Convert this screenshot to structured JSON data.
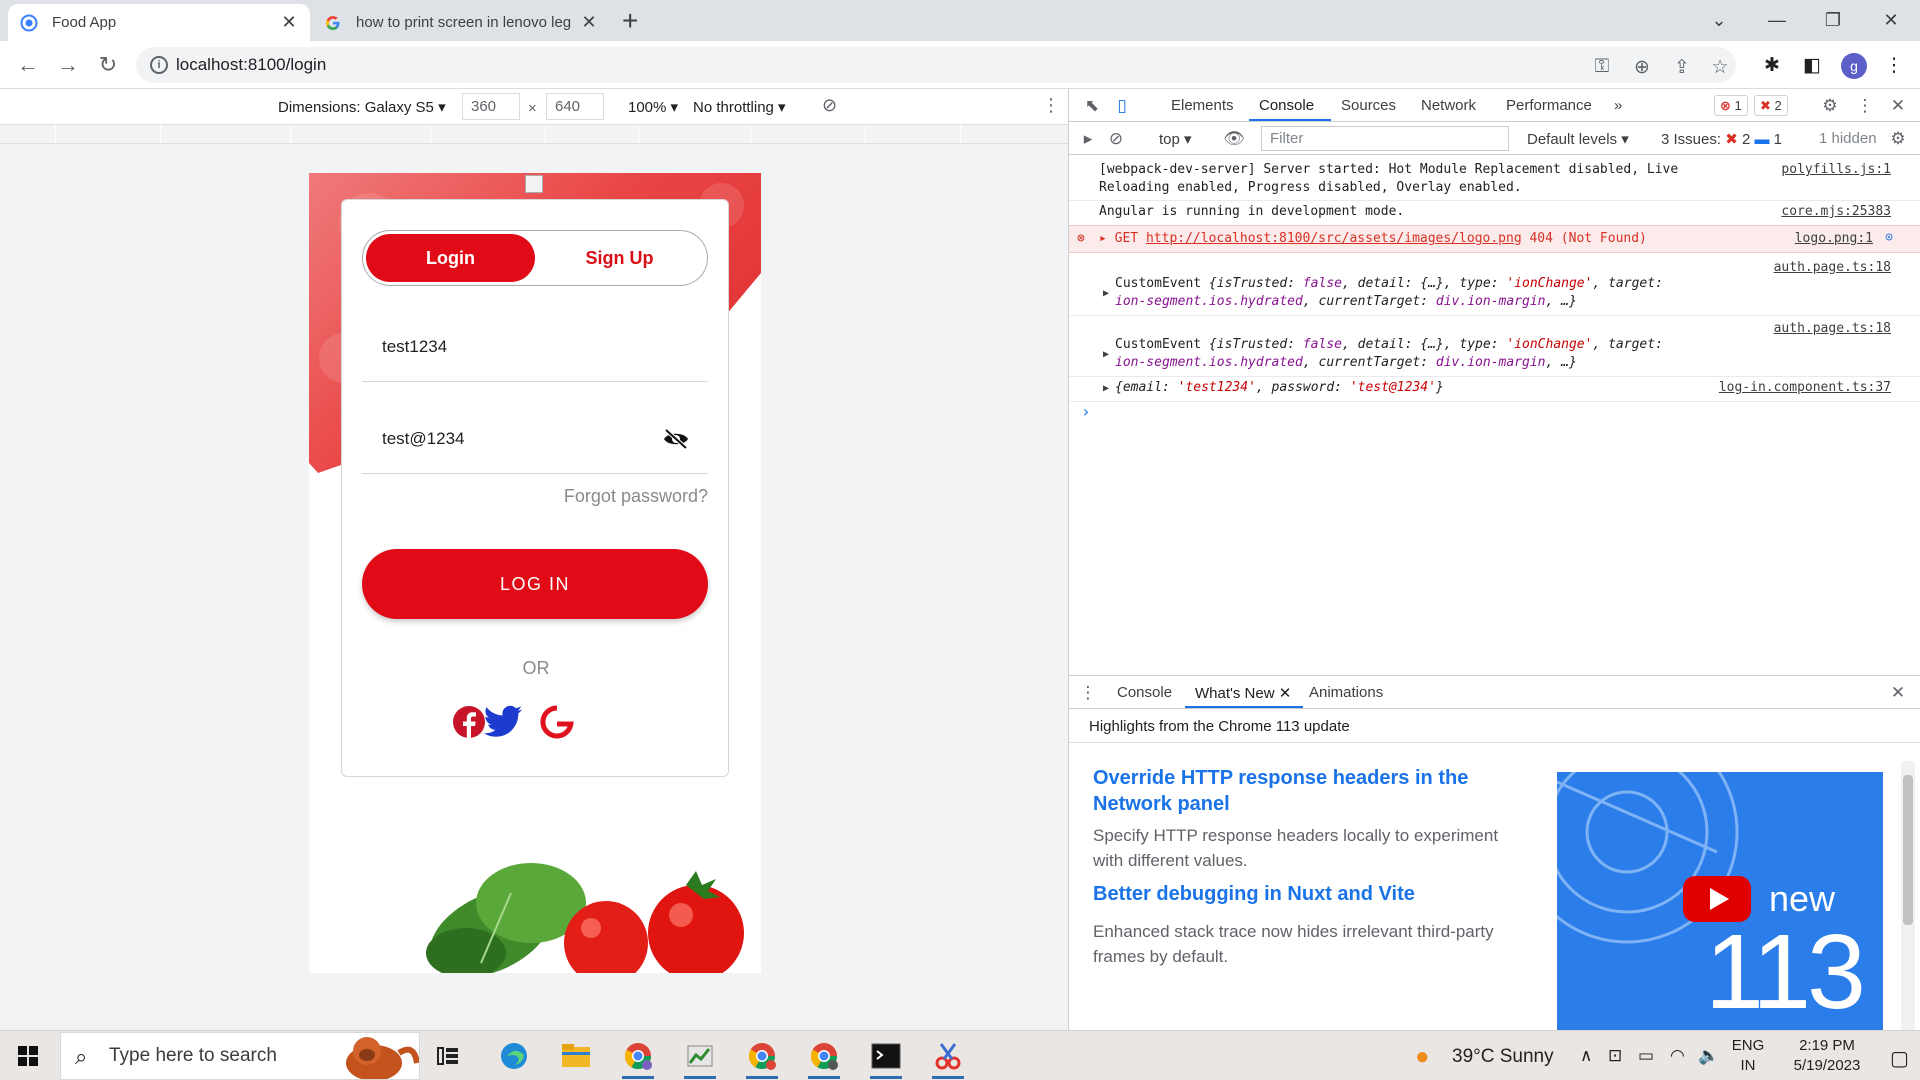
{
  "browser": {
    "tabs": [
      {
        "title": "Food App",
        "active": true
      },
      {
        "title": "how to print screen in lenovo leg",
        "active": false
      }
    ],
    "url": "localhost:8100/login",
    "profile_initial": "g"
  },
  "device_toolbar": {
    "dimensions_label": "Dimensions: Galaxy S5",
    "width": "360",
    "height": "640",
    "times": "×",
    "zoom": "100%",
    "throttling": "No throttling"
  },
  "app": {
    "segment": {
      "login": "Login",
      "signup": "Sign Up"
    },
    "username_value": "test1234",
    "password_value": "test@1234",
    "forgot_password": "Forgot password?",
    "login_button": "LOG IN",
    "or_text": "OR",
    "social": [
      "facebook-icon",
      "twitter-icon",
      "google-icon"
    ],
    "colors": {
      "primary": "#e10b17",
      "facebook": "#c81428",
      "twitter": "#1d3ccf",
      "google": "#e0121e"
    }
  },
  "devtools": {
    "tabs": [
      "Elements",
      "Console",
      "Sources",
      "Network",
      "Performance"
    ],
    "active_tab": "Console",
    "more": "»",
    "error_count": "1",
    "issue_badge_count": "2",
    "context": "top",
    "filter_placeholder": "Filter",
    "levels": "Default levels",
    "issues_label": "3 Issues:",
    "issues_errors": "2",
    "issues_info": "1",
    "hidden": "1 hidden",
    "console_lines": {
      "l1a": "[webpack-dev-server] Server started: Hot Module Replacement disabled, Live",
      "l1b": "Reloading enabled, Progress disabled, Overlay enabled.",
      "l1_src": "polyfills.js:1",
      "l2": "Angular is running in development mode.",
      "l2_src": "core.mjs:25383",
      "err_method": "GET",
      "err_url": "http://localhost:8100/src/assets/images/logo.png",
      "err_status": "404 (Not Found)",
      "err_src": "logo.png:1",
      "ev_src": "auth.page.ts:18",
      "ev_a": "CustomEvent",
      "ev_b1": "{isTrusted: ",
      "ev_false": "false",
      "ev_b2": ", detail: {…}, type: ",
      "ev_type": "'ionChange'",
      "ev_b3": ", target:",
      "ev_c1": "ion-segment.ios.hydrated",
      "ev_c2": ", currentTarget: ",
      "ev_c3": "div.ion-margin",
      "ev_c4": ", …}",
      "obj_a": "{email: ",
      "obj_email": "'test1234'",
      "obj_b": ", password: ",
      "obj_pw": "'test@1234'",
      "obj_c": "}",
      "obj_src": "log-in.component.ts:37",
      "prompt": "›"
    },
    "drawer": {
      "tabs": [
        "Console",
        "What's New",
        "Animations"
      ],
      "active": "What's New",
      "title": "Highlights from the Chrome 113 update",
      "items": [
        {
          "heading": "Override HTTP response headers in the Network panel",
          "text": "Specify HTTP response headers locally to experiment with different values."
        },
        {
          "heading": "Better debugging in Nuxt and Vite",
          "text": "Enhanced stack trace now hides irrelevant third-party frames by default."
        }
      ],
      "promo_new": "new",
      "promo_version": "113"
    }
  },
  "taskbar": {
    "search_placeholder": "Type here to search",
    "weather": "39°C  Sunny",
    "lang_top": "ENG",
    "lang_bottom": "IN",
    "time": "2:19 PM",
    "date": "5/19/2023"
  }
}
